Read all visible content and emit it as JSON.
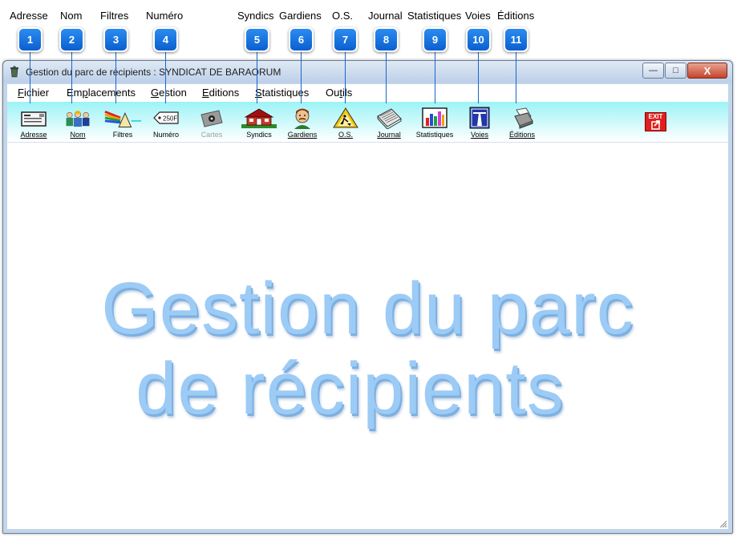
{
  "callouts": [
    {
      "number": "1",
      "label": "Adresse"
    },
    {
      "number": "2",
      "label": "Nom"
    },
    {
      "number": "3",
      "label": "Filtres"
    },
    {
      "number": "4",
      "label": "Numéro"
    },
    {
      "number": "5",
      "label": "Syndics"
    },
    {
      "number": "6",
      "label": "Gardiens"
    },
    {
      "number": "7",
      "label": "O.S."
    },
    {
      "number": "8",
      "label": "Journal"
    },
    {
      "number": "9",
      "label": "Statistiques"
    },
    {
      "number": "10",
      "label": "Voies"
    },
    {
      "number": "11",
      "label": "Éditions"
    }
  ],
  "window": {
    "title": "Gestion du parc de récipients : SYNDICAT DE BARAORUM",
    "controls": {
      "minimize": "—",
      "maximize": "□",
      "close": "X"
    }
  },
  "menubar": {
    "items": [
      {
        "first": "F",
        "rest": "ichier"
      },
      {
        "first": "Em",
        "u": "p",
        "rest": "lacements"
      },
      {
        "first": "",
        "u": "G",
        "rest": "estion"
      },
      {
        "first": "",
        "u": "E",
        "rest": "ditions"
      },
      {
        "first": "",
        "u": "S",
        "rest": "tatistiques"
      },
      {
        "first": "Ou",
        "u": "t",
        "rest": "ils"
      }
    ]
  },
  "toolbar": {
    "buttons": [
      {
        "label": "Adresse",
        "icon": "address-card-icon",
        "enabled": true
      },
      {
        "label": "Nom",
        "icon": "people-icon",
        "enabled": true
      },
      {
        "label": "Filtres",
        "icon": "prism-filter-icon",
        "enabled": true
      },
      {
        "label": "Numéro",
        "icon": "number-tag-icon",
        "enabled": true
      },
      {
        "label": "Cartes",
        "icon": "card-reader-icon",
        "enabled": false
      },
      {
        "label": "Syndics",
        "icon": "house-icon",
        "enabled": true
      },
      {
        "label": "Gardiens",
        "icon": "guard-face-icon",
        "enabled": true
      },
      {
        "label": "O.S.",
        "icon": "roadwork-sign-icon",
        "enabled": true
      },
      {
        "label": "Journal",
        "icon": "journal-book-icon",
        "enabled": true
      },
      {
        "label": "Statistiques",
        "icon": "bar-chart-icon",
        "enabled": true
      },
      {
        "label": "Voies",
        "icon": "highway-sign-icon",
        "enabled": true
      },
      {
        "label": "Éditions",
        "icon": "printer-icon",
        "enabled": true
      }
    ],
    "exit_label": "EXIT"
  },
  "splash": {
    "line1": "Gestion du parc",
    "line2": "de récipients"
  },
  "colors": {
    "splash_text": "#9ccbf6",
    "toolbar_gradient_top": "#9cf3f6",
    "callout_bubble": "#1a73e0"
  }
}
